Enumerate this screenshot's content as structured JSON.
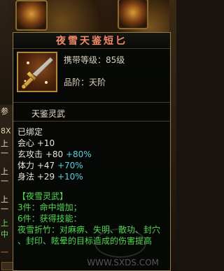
{
  "background": {
    "side_labels": [
      {
        "text": "参",
        "color": "#e8d8b0"
      },
      {
        "text": "8X",
        "color": "#e8d8b0"
      },
      {
        "text": "上",
        "color": "#e8d8b0"
      },
      {
        "text": "一",
        "color": "#e8d8b0"
      },
      {
        "text": "上",
        "color": "#e8d8b0"
      },
      {
        "text": "一",
        "color": "#e8d8b0"
      },
      {
        "text": "上",
        "color": "#e8d8b0"
      },
      {
        "text": "一",
        "color": "#e8d8b0"
      },
      {
        "text": "上",
        "color": "#6bd86b"
      },
      {
        "text": "中",
        "color": "#6bd86b"
      },
      {
        "text": "一",
        "color": "#e06a3a"
      }
    ]
  },
  "tooltip": {
    "title": "夜雪天鉴短匕",
    "item_icon": "dagger-icon",
    "requirement": "携带等级：85级",
    "grade": "品阶：天阶",
    "subtitle": "天鉴灵武",
    "lines": [
      {
        "text": "已绑定",
        "bonus": "",
        "kind": "plain"
      },
      {
        "text": "会心 +10",
        "bonus": "",
        "kind": "plain"
      },
      {
        "text": "玄攻击 +80 ",
        "bonus": "+80%",
        "kind": "plain"
      },
      {
        "text": "体力 +47 ",
        "bonus": "+70%",
        "kind": "plain"
      },
      {
        "text": "身法 +29 ",
        "bonus": "+10%",
        "kind": "plain"
      },
      {
        "text": "",
        "bonus": "",
        "kind": "spacer"
      },
      {
        "text": "【夜雪灵武】",
        "bonus": "",
        "kind": "set-name"
      },
      {
        "text": "3件：命中增加；",
        "bonus": "",
        "kind": "set"
      },
      {
        "text": "6件：获得技能：",
        "bonus": "",
        "kind": "set"
      },
      {
        "text": "夜雪折竹：对麻痹、失明、散功、封穴",
        "bonus": "",
        "kind": "set"
      },
      {
        "text": "、封印、眩晕的目标造成的伤害提高",
        "bonus": "",
        "kind": "set"
      }
    ],
    "colors": {
      "title": "#f08a6a",
      "bonus": "#58d0e0",
      "set": "#4fd84f"
    }
  },
  "watermark": {
    "text": "WWW.SXDS.COM"
  }
}
